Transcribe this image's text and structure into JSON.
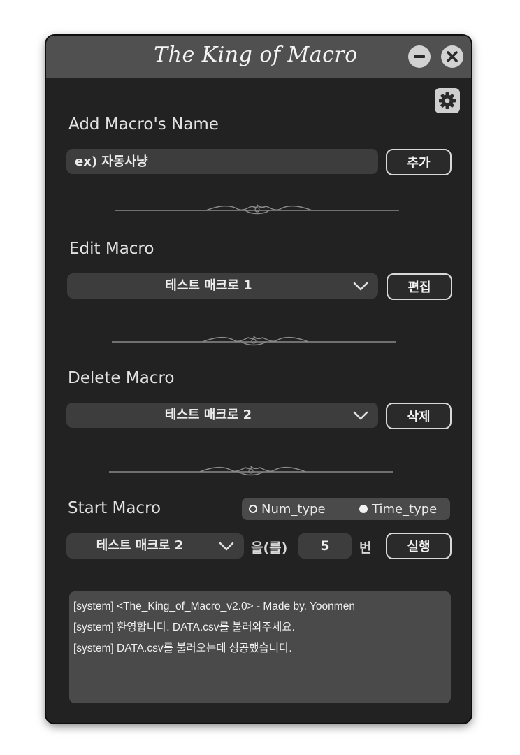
{
  "window": {
    "title": "The King of Macro",
    "minimize_icon": "minus-icon",
    "close_icon": "x-icon",
    "settings_icon": "gear-icon"
  },
  "add_macro": {
    "label": "Add Macro's Name",
    "input_placeholder": "ex) 자동사냥",
    "button_label": "추가"
  },
  "edit_macro": {
    "label": "Edit Macro",
    "selected": "테스트 매크로 1",
    "button_label": "편집"
  },
  "delete_macro": {
    "label": "Delete Macro",
    "selected": "테스트 매크로 2",
    "button_label": "삭제"
  },
  "start_macro": {
    "label": "Start Macro",
    "mode_options": [
      {
        "label": "Num_type",
        "selected": false
      },
      {
        "label": "Time_type",
        "selected": true
      }
    ],
    "selected": "테스트 매크로 2",
    "particle": "을(를)",
    "count": "5",
    "unit": "번",
    "button_label": "실행"
  },
  "log": {
    "lines": [
      "[system] <The_King_of_Macro_v2.0> - Made by. Yoonmen",
      "[system] 환영합니다. DATA.csv를 불러와주세요.",
      "[system] DATA.csv를 불러오는데 성공했습니다."
    ]
  },
  "colors": {
    "window_bg": "#222222",
    "titlebar_bg": "#505050",
    "field_bg": "#3d3d3d",
    "log_bg": "#4a4a4a",
    "text": "#e2e2e2"
  }
}
